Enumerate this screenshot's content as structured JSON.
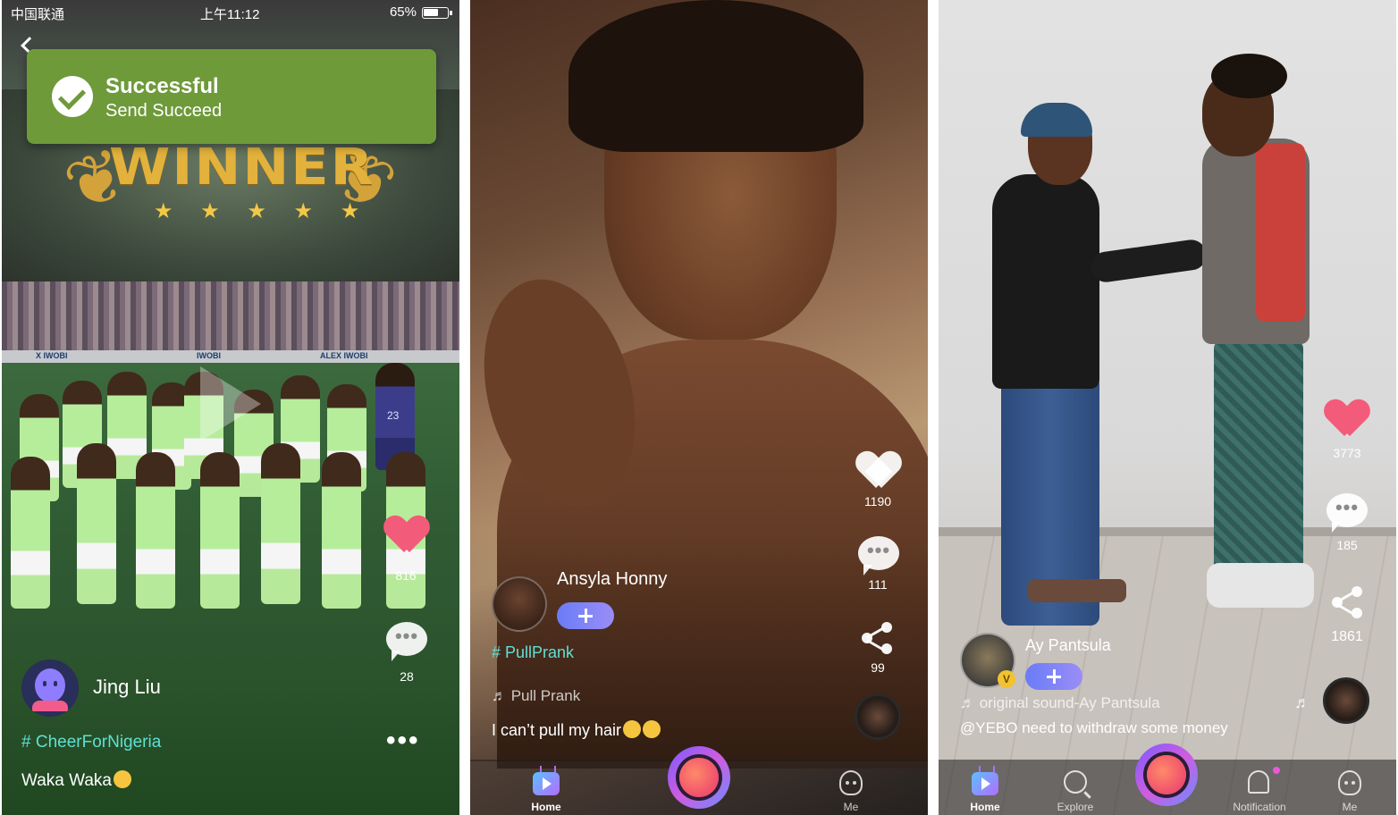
{
  "statusbar": {
    "carrier": "中国联通",
    "time": "上午11:12",
    "battery": "65%",
    "battery_level": 0.65
  },
  "toast": {
    "title": "Successful",
    "subtitle": "Send Succeed"
  },
  "banner": {
    "text": "WINNER",
    "stars": "★ ★ ★ ★ ★"
  },
  "board_names": [
    "X IWOBI",
    "IWOBI",
    "ALEX IWOBI"
  ],
  "jersey_number": "23",
  "posts": [
    {
      "likes": "816",
      "comments": "28",
      "username": "Jing Liu",
      "hashtag": "# CheerForNigeria",
      "caption": "Waka Waka",
      "more": "•••"
    },
    {
      "likes": "1190",
      "comments": "111",
      "shares": "99",
      "username": "Ansyla Honny",
      "hashtag": "# PullPrank",
      "music": "♬ Pull Prank",
      "caption": "I can’t pull my hair"
    },
    {
      "likes": "3773",
      "comments": "185",
      "shares": "1861",
      "username": "Ay Pantsula",
      "badge": "V",
      "music": "♬ original sound-Ay Pantsula",
      "caption": "@YEBO   need to  withdraw some money"
    }
  ],
  "tabs": {
    "home": "Home",
    "explore": "Explore",
    "notification": "Notification",
    "me": "Me"
  },
  "icons": [
    "back-icon",
    "checkmark-icon",
    "play-icon",
    "heart-icon",
    "comment-icon",
    "share-icon",
    "music-note-icon",
    "home-tv-icon",
    "search-icon",
    "bell-icon",
    "me-icon",
    "record-icon",
    "follow-plus-icon"
  ],
  "colors": {
    "toast": "#6e9a3a",
    "hashtag": "#5fe0d4",
    "like_active": "#f25c7a",
    "follow_button": "#6a7cf7"
  }
}
